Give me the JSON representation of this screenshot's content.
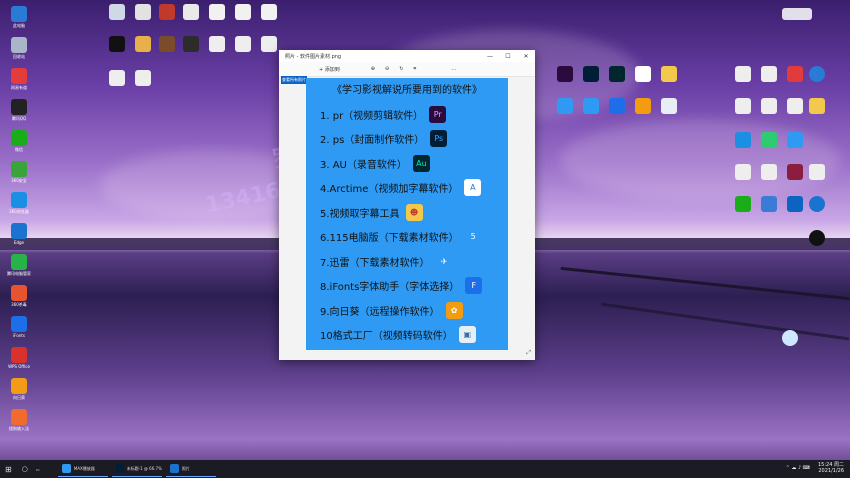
{
  "desktop": {
    "left_icons": [
      {
        "label": "此电脑",
        "color": "#2a7bd6"
      },
      {
        "label": "回收站",
        "color": "#a9b6c9"
      },
      {
        "label": "网易有道",
        "color": "#e43c3c"
      },
      {
        "label": "腾讯QQ",
        "color": "#222"
      },
      {
        "label": "微信",
        "color": "#1aad19"
      },
      {
        "label": "360安全",
        "color": "#3aa33a"
      },
      {
        "label": "360浏览器",
        "color": "#1a8fe3"
      },
      {
        "label": "Edge",
        "color": "#1b73d0"
      },
      {
        "label": "腾讯电脑管家",
        "color": "#27b34a"
      },
      {
        "label": "360杀毒",
        "color": "#e8532f"
      },
      {
        "label": "iFonts",
        "color": "#1c6fe8"
      },
      {
        "label": "WPS Office",
        "color": "#d9322c"
      },
      {
        "label": "向日葵",
        "color": "#f29b17"
      },
      {
        "label": "搜狗输入法",
        "color": "#f06b2d"
      }
    ],
    "watermark_line1": "罗",
    "watermark_line2": "1341604316"
  },
  "window": {
    "title": "照片 - 软件图片素材.png",
    "controls": {
      "minimize": "—",
      "maximize": "☐",
      "close": "✕"
    },
    "toolbar": {
      "add": "+ 添加到",
      "zoom_in": "⊕",
      "zoom_out": "⊖",
      "rotate": "↻",
      "crop": "⌗",
      "more": "…"
    },
    "tab_label": "查看所有照片"
  },
  "canvas": {
    "title": "《学习影视解说所要用到的软件》",
    "items": [
      {
        "text": "1. pr（视频剪辑软件）",
        "icon": "Pr",
        "bg": "#2b0a3d",
        "fg": "#e49cff"
      },
      {
        "text": "2. ps（封面制作软件）",
        "icon": "Ps",
        "bg": "#001e36",
        "fg": "#31a8ff"
      },
      {
        "text": "3. AU（录音软件）",
        "icon": "Au",
        "bg": "#00272e",
        "fg": "#00e4bb"
      },
      {
        "text": "4.Arctime（视频加字幕软件）",
        "icon": "A",
        "bg": "#ffffff",
        "fg": "#1f7ae0"
      },
      {
        "text": "5.视频取字幕工具",
        "icon": "☻",
        "bg": "#f2c94c",
        "fg": "#c0392b"
      },
      {
        "text": "6.115电脑版（下载素材软件）",
        "icon": "5",
        "bg": "#2f9af3",
        "fg": "#ffffff"
      },
      {
        "text": "7.迅雷（下载素材软件）",
        "icon": "✈",
        "bg": "#2f9af3",
        "fg": "#ffffff"
      },
      {
        "text": "8.iFonts字体助手（字体选择）",
        "icon": "F",
        "bg": "#1c6fe8",
        "fg": "#ffffff"
      },
      {
        "text": "9.向日葵（远程操作软件）",
        "icon": "✿",
        "bg": "#f39c12",
        "fg": "#ffffff"
      },
      {
        "text": "10格式工厂（视频转码软件）",
        "icon": "▣",
        "bg": "#e8eef5",
        "fg": "#3a6ea5"
      }
    ]
  },
  "taskbar": {
    "start": "⊞",
    "search": "○",
    "items": [
      {
        "label": "MAX播放器",
        "color": "#2f9af3"
      },
      {
        "label": "未标题-1 @ 66.7% ...",
        "color": "#001e36"
      },
      {
        "label": "照片",
        "color": "#1b73d0"
      }
    ],
    "clock_time": "15:24 周二",
    "clock_date": "2021/1/26"
  },
  "colors": {
    "accent": "#2f9af3",
    "taskbar": "#1b1b24"
  }
}
